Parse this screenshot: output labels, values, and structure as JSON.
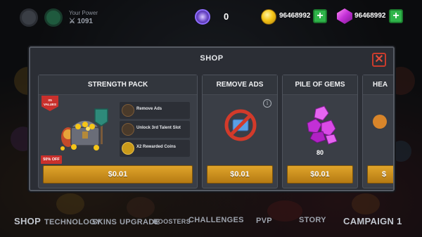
{
  "hud": {
    "power_label": "Your Power",
    "power_value": "1091",
    "tokens": "0",
    "coins": "96468992",
    "gems": "96468992",
    "plus": "+"
  },
  "shop": {
    "title": "SHOP",
    "close": "✕",
    "cards": [
      {
        "title": "STRENGTH PACK",
        "badge_values": "X5 VALUES",
        "badge_off": "50% OFF",
        "features": [
          "Remove Ads",
          "Unlock 3rd Talent Slot",
          "X2 Rewarded Coins"
        ],
        "price": "$0.01"
      },
      {
        "title": "REMOVE ADS",
        "info": "i",
        "price": "$0.01"
      },
      {
        "title": "PILE OF GEMS",
        "amount": "80",
        "price": "$0.01"
      },
      {
        "title": "HEA",
        "price": "$"
      }
    ]
  },
  "nav": {
    "shop": "SHOP",
    "technology": "TECHNOLOGY",
    "skins": "SKINS",
    "upgrade": "UPGRADE",
    "boosters": "BOOSTERS",
    "challenges": "CHALLENGES",
    "pvp": "PVP",
    "story": "STORY",
    "campaign": "CAMPAIGN 1"
  },
  "colors": {
    "accent_gold": "#d39a22",
    "badge_red": "#c9302c",
    "plus_green": "#2fb54a",
    "gem_purple": "#c230d6",
    "close_red": "#e24a38"
  }
}
